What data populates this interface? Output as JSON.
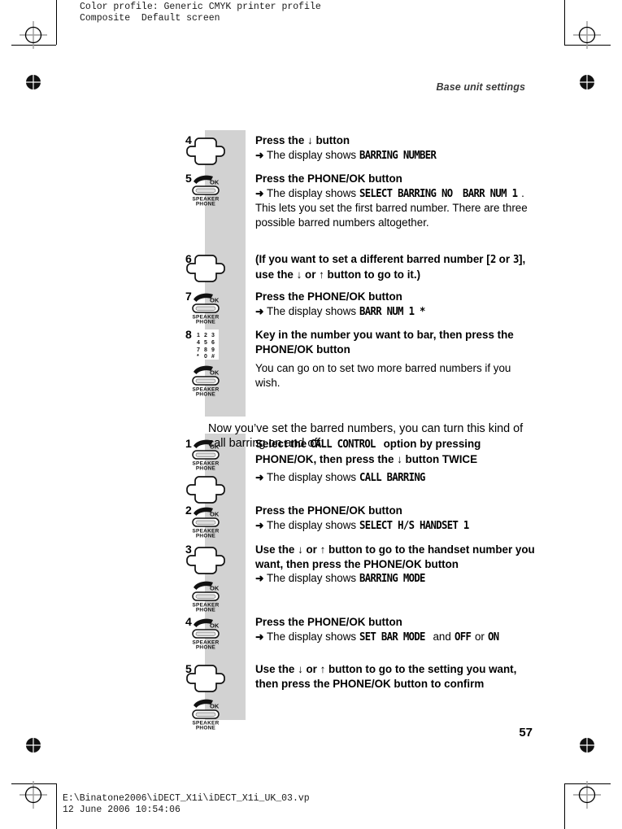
{
  "proof": {
    "header_line1": "Color profile: Generic CMYK printer profile",
    "header_line2": "Composite  Default screen",
    "footer_line1": "E:\\Binatone2006\\iDECT_X1i\\iDECT_X1i_UK_03.vp",
    "footer_line2": "12 June 2006 10:54:06"
  },
  "page": {
    "running_head": "Base unit settings",
    "page_number": "57",
    "icon_rail_color": "#d2d2d2"
  },
  "icons": {
    "dpad": "dpad-navigation-icon",
    "phone_ok": "phone-ok-speakerphone-icon",
    "keypad": "numeric-keypad-icon",
    "keypad_keys": [
      "1",
      "2",
      "3",
      "4",
      "5",
      "6",
      "7",
      "8",
      "9",
      "*",
      "0",
      "#"
    ],
    "phone_label_ok": "OK",
    "phone_label_line1": "SPEAKER",
    "phone_label_line2": "PHONE"
  },
  "section_one": {
    "steps": [
      {
        "number": "4",
        "icon": "dpad",
        "lead_pre": "Press the ",
        "lead_arrow": "↓",
        "lead_post": " button",
        "arrow_pre": "The display shows ",
        "lcd": "BARRING NUMBER",
        "arrow_post": ""
      },
      {
        "number": "5",
        "icon": "phone_ok",
        "lead_pre": "Press the ",
        "lead_bold": "PHONE/OK",
        "lead_post": " button",
        "arrow_pre": "The display shows ",
        "lcd": "SELECT BARRING NO",
        "lcd2": "BARR NUM 1",
        "arrow_post": ". This lets you set the first barred number. There are three possible barred numbers altogether."
      },
      {
        "number": "6",
        "icon": "dpad",
        "lead_pre": "(If you want to set a different barred number [",
        "lcd": "2",
        "lead_mid": " or ",
        "lcd2": "3",
        "lead_post": "], use the ↓ or ↑ button to go to it.)"
      },
      {
        "number": "7",
        "icon": "phone_ok",
        "lead_pre": "Press the ",
        "lead_bold": "PHONE/OK",
        "lead_post": " button",
        "arrow_pre": "The display shows ",
        "lcd": "BARR NUM 1  *",
        "arrow_post": ""
      },
      {
        "number": "8",
        "icon": "keypad_phone",
        "lead_pre": "Key in the number you want to bar, then press the ",
        "lead_bold": "PHONE/OK",
        "lead_post": " button",
        "note": "You can go on to set two more barred numbers if you wish."
      }
    ]
  },
  "interlude": {
    "text": "Now you’ve set the barred numbers, you can turn this kind of call barring on and off:"
  },
  "section_two": {
    "steps": [
      {
        "number": "1",
        "icon": "phone_then_dpad",
        "lead_pre": "Select the ",
        "lcd": "CALL CONTROL",
        "lead_mid": " option by pressing ",
        "lead_bold": "PHONE/OK",
        "lead_post": ", then press the ↓ button TWICE",
        "arrow_pre": "The display shows ",
        "lcd2": "CALL BARRING",
        "arrow_post": ""
      },
      {
        "number": "2",
        "icon": "phone_ok",
        "lead_pre": "Press the ",
        "lead_bold": "PHONE/OK",
        "lead_post": " button",
        "arrow_pre": "The display shows ",
        "lcd": "SELECT H/S  HANDSET 1",
        "arrow_post": ""
      },
      {
        "number": "3",
        "icon": "dpad_then_phone",
        "lead_pre": "Use the ↓ or ↑ button to go to the handset number you want, then press the ",
        "lead_bold": "PHONE/OK",
        "lead_post": " button",
        "arrow_pre": "The display shows ",
        "lcd": "BARRING MODE",
        "arrow_post": ""
      },
      {
        "number": "4",
        "icon": "phone_ok",
        "lead_pre": "Press the ",
        "lead_bold": "PHONE/OK",
        "lead_post": " button",
        "arrow_pre": "The display shows ",
        "lcd": "SET BAR MODE",
        "arrow_mid": " and ",
        "lcd2": "OFF",
        "arrow_mid2": " or ",
        "lcd3": "ON",
        "arrow_post": ""
      },
      {
        "number": "5",
        "icon": "dpad_then_phone",
        "lead_pre": "Use the ↓ or ↑ button to go to the setting you want, then press the ",
        "lead_bold": "PHONE/OK",
        "lead_post": " button to confirm"
      }
    ]
  }
}
